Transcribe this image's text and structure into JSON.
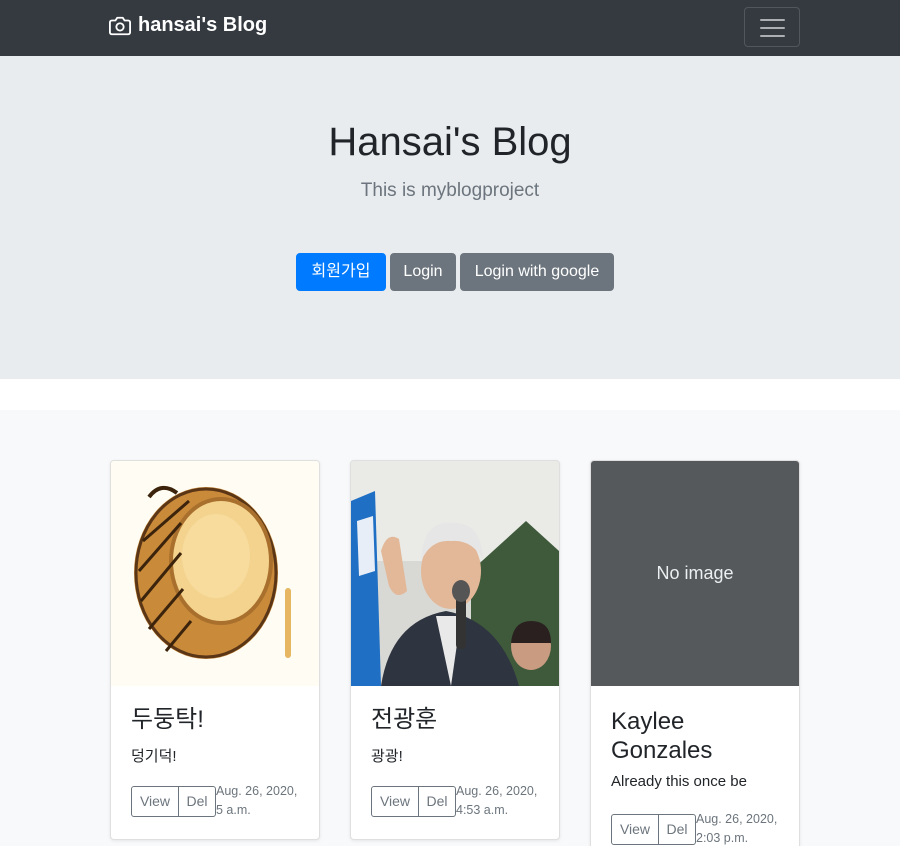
{
  "navbar": {
    "brand": "hansai's Blog",
    "icon": "camera-icon",
    "menu_icon": "hamburger-icon"
  },
  "hero": {
    "title": "Hansai's Blog",
    "lead": "This is myblogproject",
    "buttons": {
      "signup": "회원가입",
      "login": "Login",
      "google": "Login with google"
    }
  },
  "colors": {
    "navbar": "#343a40",
    "jumbotron": "#e9ecef",
    "primary": "#007bff",
    "secondary": "#6c757d",
    "album_bg": "#f8f9fa",
    "placeholder": "#55595c"
  },
  "posts": [
    {
      "title": "두둥탁!",
      "text": "덩기덕!",
      "view": "View",
      "del": "Del",
      "date_line1": "Aug. 26, 2020,",
      "date_line2": "5 a.m.",
      "image": "drum-photo"
    },
    {
      "title": "전광훈",
      "text": "광광!",
      "view": "View",
      "del": "Del",
      "date_line1": "Aug. 26, 2020,",
      "date_line2": "4:53 a.m.",
      "image": "speaker-photo"
    },
    {
      "title": "Kaylee Gonzales",
      "text": "Already this once be",
      "view": "View",
      "del": "Del",
      "date_line1": "Aug. 26, 2020,",
      "date_line2": "2:03 p.m.",
      "image_placeholder": "No image"
    }
  ]
}
